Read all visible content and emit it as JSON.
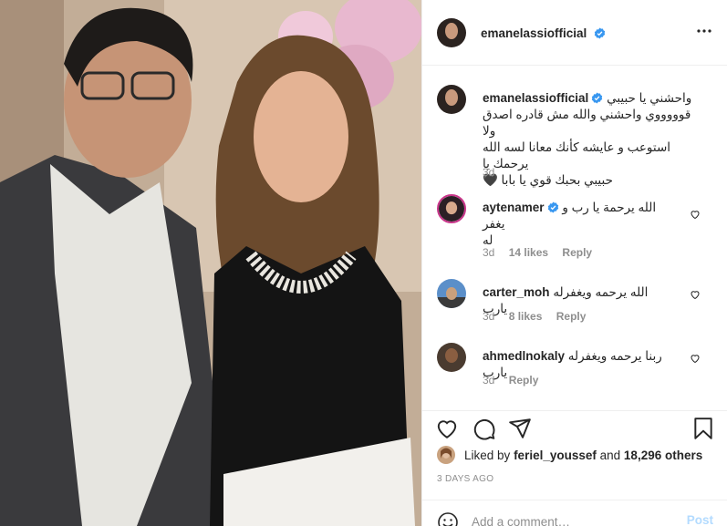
{
  "post": {
    "author": "emanelassiofficial",
    "caption_lines": [
      "واحشني يا حبيبي",
      "قوووووي واحشني والله مش قادره اصدق ولا",
      "استوعب و عايشه كأنك معانا لسه الله يرحمك يا",
      "حبيبي بحبك قوي يا بابا 🖤"
    ],
    "caption_time": "3d"
  },
  "comments": [
    {
      "user": "aytenamer",
      "verified": true,
      "lines": [
        "الله يرحمة يا رب و يغفر",
        "له"
      ],
      "time": "3d",
      "likes": "14 likes",
      "reply": "Reply"
    },
    {
      "user": "carter_moh",
      "verified": false,
      "lines": [
        "الله يرحمه ويغفرله يارب"
      ],
      "time": "3d",
      "likes": "8 likes",
      "reply": "Reply"
    },
    {
      "user": "ahmedlnokaly",
      "verified": false,
      "lines": [
        "ربنا يرحمه ويغفرله يارب"
      ],
      "time": "3d",
      "likes": "",
      "reply": "Reply"
    }
  ],
  "likes": {
    "prefix": "Liked by",
    "user": "feriel_youssef",
    "and": "and",
    "count": "18,296 others"
  },
  "date": "3 DAYS AGO",
  "add_comment": {
    "placeholder": "Add a comment…",
    "post_label": "Post"
  },
  "colors": {
    "verified": "#3897f0",
    "text": "#262626",
    "muted": "#8e8e8e",
    "post_disabled": "#b3dbff",
    "border": "#efefef"
  },
  "icons": [
    "more-icon",
    "heart-icon",
    "comment-icon",
    "share-icon",
    "bookmark-icon",
    "smile-icon",
    "verified-badge-icon"
  ]
}
